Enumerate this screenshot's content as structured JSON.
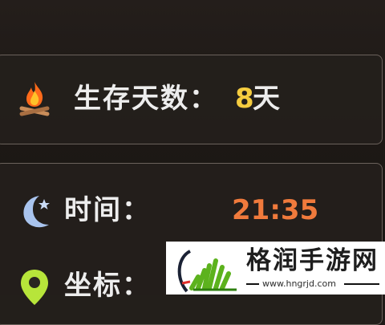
{
  "stats": {
    "days": {
      "icon": "campfire-icon",
      "label": "生存天数：",
      "value": "8",
      "unit": "天"
    },
    "time": {
      "icon": "moon-icon",
      "label": "时间：",
      "value": "21:35"
    },
    "coords": {
      "icon": "location-pin-icon",
      "label": "坐标："
    }
  },
  "watermark": {
    "title": "格润手游网",
    "url": "www.hngrjd.com",
    "logo_icon": "grass-logo-icon"
  },
  "colors": {
    "day_value": "#f5cc3f",
    "time_value": "#f07a3c",
    "label": "#ededed",
    "panel_border": "#6b625c",
    "logo_green": "#5cb21d"
  }
}
